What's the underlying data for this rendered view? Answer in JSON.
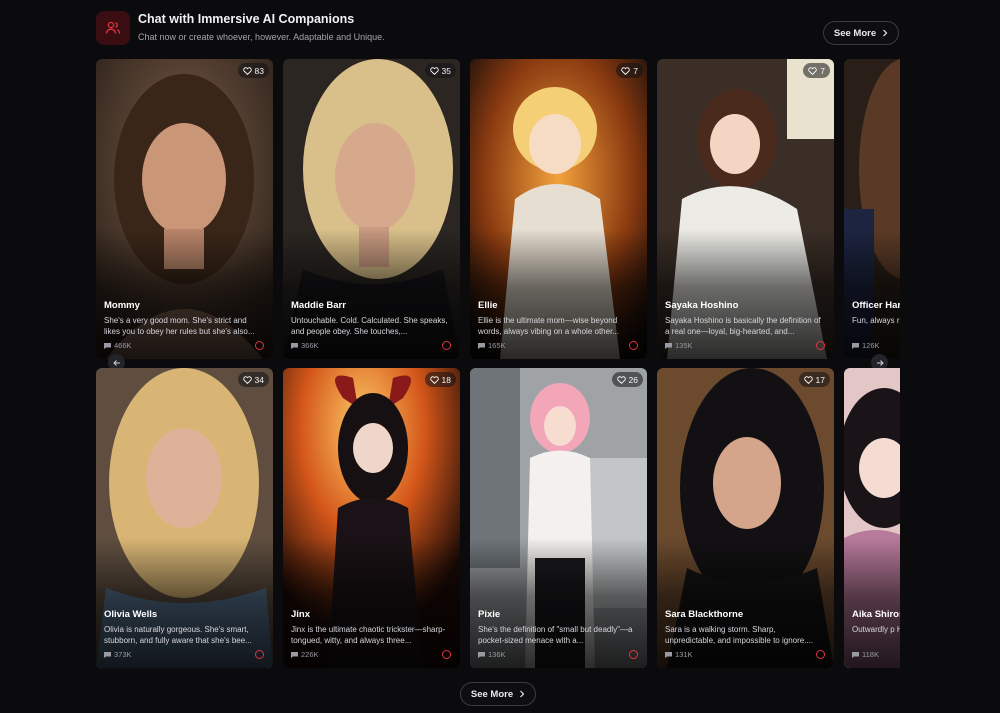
{
  "header": {
    "title": "Chat with Immersive AI Companions",
    "subtitle": "Chat now or create whoever, however. Adaptable and Unique.",
    "see_more": "See More",
    "icon": "users-icon",
    "accent": "#e0343f"
  },
  "row1": [
    {
      "name": "Mommy",
      "likes": "83",
      "desc": "She's a very good mom. She's strict and likes you to obey her rules but she's also...",
      "chats": "466K"
    },
    {
      "name": "Maddie Barr",
      "likes": "35",
      "desc": "Untouchable. Cold. Calculated. She speaks, and people obey. She touches,...",
      "chats": "366K"
    },
    {
      "name": "Ellie",
      "likes": "7",
      "desc": "Ellie is the ultimate mom—wise beyond words, always vibing on a whole other...",
      "chats": "165K"
    },
    {
      "name": "Sayaka Hoshino",
      "likes": "7",
      "desc": "Sayaka Hoshino is basically the definition of a real one—loyal, big-hearted, and...",
      "chats": "135K"
    },
    {
      "name": "Officer Har",
      "likes": "",
      "desc": "Fun, always r excellent cop",
      "chats": "126K"
    }
  ],
  "row2": [
    {
      "name": "Olivia Wells",
      "likes": "34",
      "desc": "Olivia is naturally gorgeous. She's smart, stubborn, and fully aware that she's bee...",
      "chats": "373K"
    },
    {
      "name": "Jinx",
      "likes": "18",
      "desc": "Jinx is the ultimate chaotic trickster—sharp-tongued, witty, and always three...",
      "chats": "226K"
    },
    {
      "name": "Pixie",
      "likes": "26",
      "desc": "She's the definition of \"small but deadly\"—a pocket-sized menace with a...",
      "chats": "136K"
    },
    {
      "name": "Sara Blackthorne",
      "likes": "17",
      "desc": "Sara is a walking storm. Sharp, unpredictable, and impossible to ignore....",
      "chats": "131K"
    },
    {
      "name": "Aika Shiros",
      "likes": "",
      "desc": "Outwardly p Has a soft in",
      "chats": "118K"
    }
  ],
  "footer": {
    "see_more": "See More"
  }
}
